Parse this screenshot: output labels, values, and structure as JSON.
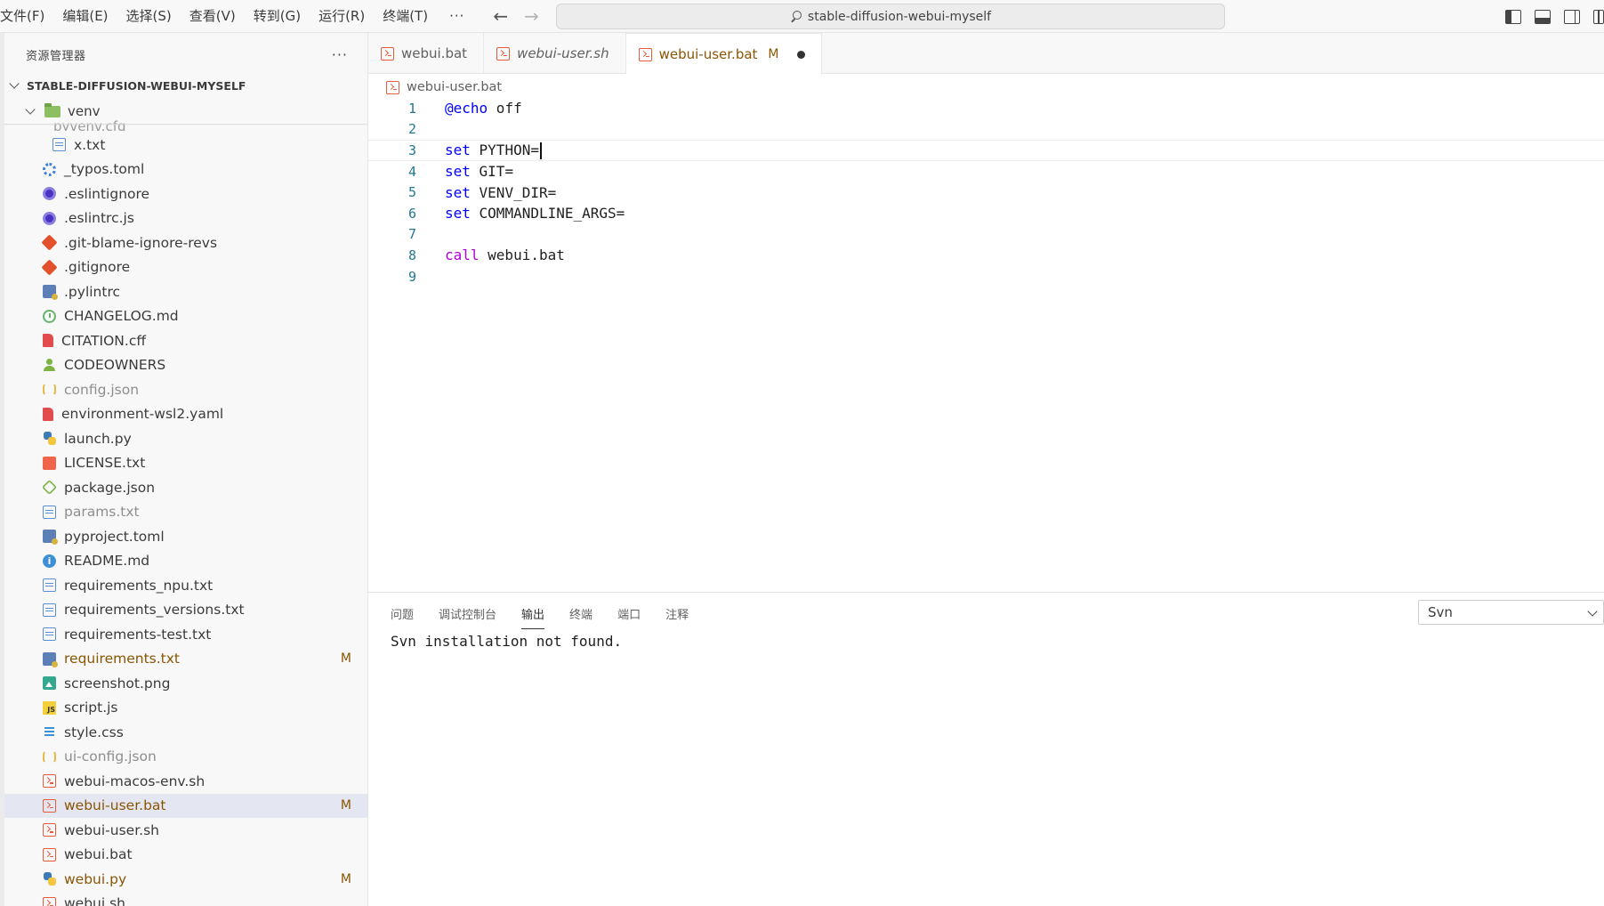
{
  "menu": [
    "文件(F)",
    "编辑(E)",
    "选择(S)",
    "查看(V)",
    "转到(G)",
    "运行(R)",
    "终端(T)"
  ],
  "menu_more": "···",
  "command_center": "stable-diffusion-webui-myself",
  "sidebar": {
    "title": "资源管理器",
    "more": "···",
    "root_folder": "STABLE-DIFFUSION-WEBUI-MYSELF",
    "venv_folder": "venv",
    "partial_item": "pyvenv.cfg",
    "files": [
      {
        "name": "x.txt",
        "icon": "text-file-icon",
        "status": "normal",
        "badge": ""
      },
      {
        "name": "_typos.toml",
        "icon": "gear-icon",
        "status": "normal",
        "badge": ""
      },
      {
        "name": ".eslintignore",
        "icon": "eslint-icon",
        "status": "normal",
        "badge": ""
      },
      {
        "name": ".eslintrc.js",
        "icon": "eslint-icon",
        "status": "normal",
        "badge": ""
      },
      {
        "name": ".git-blame-ignore-revs",
        "icon": "git-icon",
        "status": "normal",
        "badge": ""
      },
      {
        "name": ".gitignore",
        "icon": "git-icon",
        "status": "normal",
        "badge": ""
      },
      {
        "name": ".pylintrc",
        "icon": "pylint-icon",
        "status": "normal",
        "badge": ""
      },
      {
        "name": "CHANGELOG.md",
        "icon": "changelog-icon",
        "status": "normal",
        "badge": ""
      },
      {
        "name": "CITATION.cff",
        "icon": "red-document-icon",
        "status": "normal",
        "badge": ""
      },
      {
        "name": "CODEOWNERS",
        "icon": "owners-icon",
        "status": "normal",
        "badge": ""
      },
      {
        "name": "config.json",
        "icon": "json-icon",
        "status": "ignored",
        "badge": ""
      },
      {
        "name": "environment-wsl2.yaml",
        "icon": "red-document-icon",
        "status": "normal",
        "badge": ""
      },
      {
        "name": "launch.py",
        "icon": "python-icon",
        "status": "normal",
        "badge": ""
      },
      {
        "name": "LICENSE.txt",
        "icon": "license-icon",
        "status": "normal",
        "badge": ""
      },
      {
        "name": "package.json",
        "icon": "npm-icon",
        "status": "normal",
        "badge": ""
      },
      {
        "name": "params.txt",
        "icon": "text-file-icon",
        "status": "ignored",
        "badge": ""
      },
      {
        "name": "pyproject.toml",
        "icon": "pylint-icon",
        "status": "normal",
        "badge": ""
      },
      {
        "name": "README.md",
        "icon": "info-icon",
        "status": "normal",
        "badge": ""
      },
      {
        "name": "requirements_npu.txt",
        "icon": "text-file-icon",
        "status": "normal",
        "badge": ""
      },
      {
        "name": "requirements_versions.txt",
        "icon": "text-file-icon",
        "status": "normal",
        "badge": ""
      },
      {
        "name": "requirements-test.txt",
        "icon": "text-file-icon",
        "status": "normal",
        "badge": ""
      },
      {
        "name": "requirements.txt",
        "icon": "pylint-icon",
        "status": "modified",
        "badge": "M"
      },
      {
        "name": "screenshot.png",
        "icon": "image-icon",
        "status": "normal",
        "badge": ""
      },
      {
        "name": "script.js",
        "icon": "javascript-icon",
        "status": "normal",
        "badge": ""
      },
      {
        "name": "style.css",
        "icon": "css-icon",
        "status": "normal",
        "badge": ""
      },
      {
        "name": "ui-config.json",
        "icon": "json-icon",
        "status": "ignored",
        "badge": ""
      },
      {
        "name": "webui-macos-env.sh",
        "icon": "shell-icon",
        "status": "normal",
        "badge": ""
      },
      {
        "name": "webui-user.bat",
        "icon": "shell-icon",
        "status": "modified",
        "badge": "M",
        "selected": true
      },
      {
        "name": "webui-user.sh",
        "icon": "shell-icon",
        "status": "normal",
        "badge": ""
      },
      {
        "name": "webui.bat",
        "icon": "shell-icon",
        "status": "normal",
        "badge": ""
      },
      {
        "name": "webui.py",
        "icon": "python-icon",
        "status": "modified",
        "badge": "M"
      },
      {
        "name": "webui.sh",
        "icon": "shell-icon",
        "status": "normal",
        "badge": ""
      }
    ]
  },
  "tabs": [
    {
      "label": "webui.bat",
      "state": "normal",
      "badge": ""
    },
    {
      "label": "webui-user.sh",
      "state": "preview",
      "badge": ""
    },
    {
      "label": "webui-user.bat",
      "state": "active",
      "badge": "M"
    }
  ],
  "breadcrumb": "webui-user.bat",
  "code": {
    "current_line": 3,
    "lines": [
      {
        "n": "1",
        "kw": "@echo",
        "kw_class": "kw-echo",
        "rest": " off"
      },
      {
        "n": "2",
        "kw": "",
        "kw_class": "",
        "rest": ""
      },
      {
        "n": "3",
        "kw": "set",
        "kw_class": "kw-set",
        "rest": " PYTHON="
      },
      {
        "n": "4",
        "kw": "set",
        "kw_class": "kw-set",
        "rest": " GIT="
      },
      {
        "n": "5",
        "kw": "set",
        "kw_class": "kw-set",
        "rest": " VENV_DIR="
      },
      {
        "n": "6",
        "kw": "set",
        "kw_class": "kw-set",
        "rest": " COMMANDLINE_ARGS="
      },
      {
        "n": "7",
        "kw": "",
        "kw_class": "",
        "rest": ""
      },
      {
        "n": "8",
        "kw": "call",
        "kw_class": "kw-call",
        "rest": " webui.bat"
      },
      {
        "n": "9",
        "kw": "",
        "kw_class": "",
        "rest": ""
      }
    ]
  },
  "panel": {
    "tabs": [
      "问题",
      "调试控制台",
      "输出",
      "终端",
      "端口",
      "注释"
    ],
    "active_tab": "输出",
    "channel": "Svn",
    "output": "Svn installation not found."
  },
  "colors": {
    "modified": "#895503",
    "line_number": "#237893",
    "keyword_blue": "#0000ff",
    "keyword_purple": "#af00db",
    "selected_row": "#e4e6f1"
  }
}
